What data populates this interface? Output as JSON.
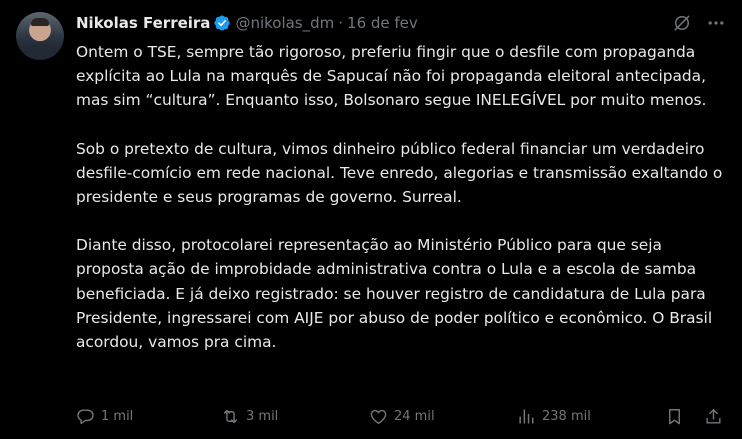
{
  "author": {
    "name": "Nikolas Ferreira",
    "handle": "@nikolas_dm",
    "separator": "·",
    "date": "16 de fev",
    "verified_color": "#1d9bf0"
  },
  "tweet": {
    "paragraphs": [
      "Ontem o TSE, sempre tão rigoroso, preferiu fingir que o desfile com propaganda explícita ao Lula na marquês de Sapucaí não foi propaganda eleitoral antecipada, mas sim “cultura”. Enquanto isso, Bolsonaro segue INELEGÍVEL por muito menos.",
      "Sob o pretexto de cultura, vimos dinheiro público federal financiar um verdadeiro desfile-comício em rede nacional. Teve enredo, alegorias e transmissão exaltando o presidente e seus programas de governo. Surreal.",
      "Diante disso, protocolarei representação ao Ministério Público para que seja proposta ação de improbidade administrativa contra o Lula e a escola de samba beneficiada. E já deixo registrado: se houver registro de candidatura de Lula para Presidente, ingressarei com AIJE por abuso de poder político e econômico. O Brasil acordou, vamos pra cima."
    ]
  },
  "actions": {
    "replies": "1 mil",
    "retweets": "3 mil",
    "likes": "24 mil",
    "views": "238 mil"
  },
  "icons": {
    "top": [
      "grok-icon",
      "more-icon"
    ],
    "bottom": [
      "reply-icon",
      "retweet-icon",
      "like-icon",
      "views-icon",
      "bookmark-icon",
      "share-icon"
    ]
  },
  "colors": {
    "background": "#000000",
    "text": "#e7e9ea",
    "muted": "#71767b"
  }
}
